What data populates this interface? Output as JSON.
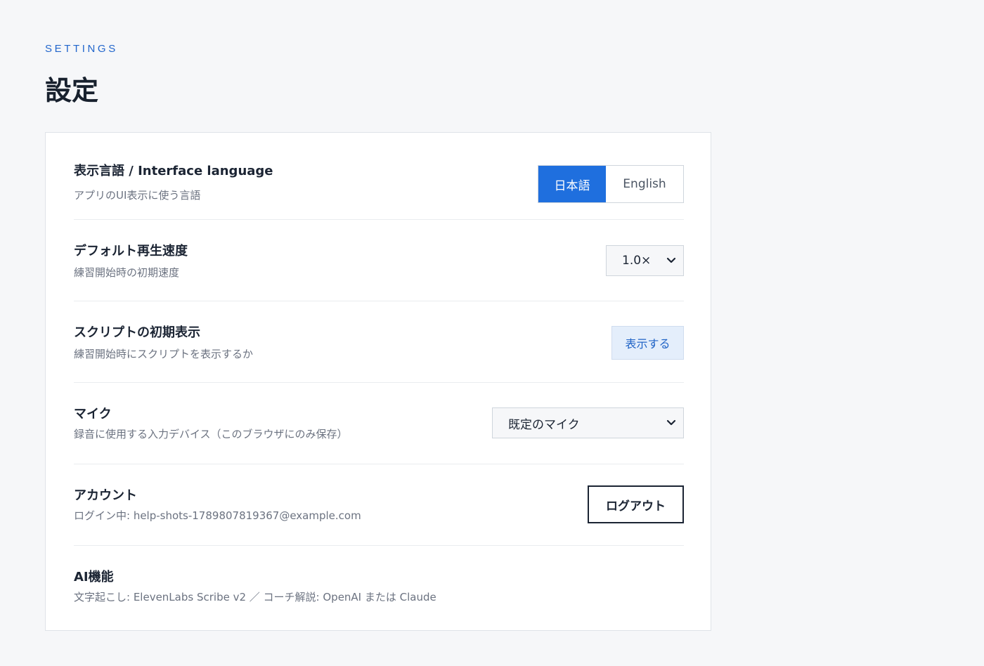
{
  "header": {
    "eyebrow": "SETTINGS",
    "title": "設定"
  },
  "language": {
    "title": "表示言語 / Interface language",
    "description": "アプリのUI表示に使う言語",
    "options": [
      "日本語",
      "English"
    ],
    "selected": "日本語"
  },
  "playback": {
    "title": "デフォルト再生速度",
    "description": "練習開始時の初期速度",
    "value": "1.0×"
  },
  "script": {
    "title": "スクリプトの初期表示",
    "description": "練習開始時にスクリプトを表示するか",
    "button_label": "表示する"
  },
  "mic": {
    "title": "マイク",
    "description": "録音に使用する入力デバイス（このブラウザにのみ保存）",
    "value": "既定のマイク"
  },
  "account": {
    "title": "アカウント",
    "description": "ログイン中: help-shots-1789807819367@example.com",
    "logout_label": "ログアウト"
  },
  "ai": {
    "title": "AI機能",
    "description": "文字起こし: ElevenLabs Scribe v2 ／ コーチ解説: OpenAI または Claude"
  },
  "colors": {
    "accent": "#1f6fde",
    "eyebrow": "#2266cc",
    "background": "#f6f7f9"
  }
}
